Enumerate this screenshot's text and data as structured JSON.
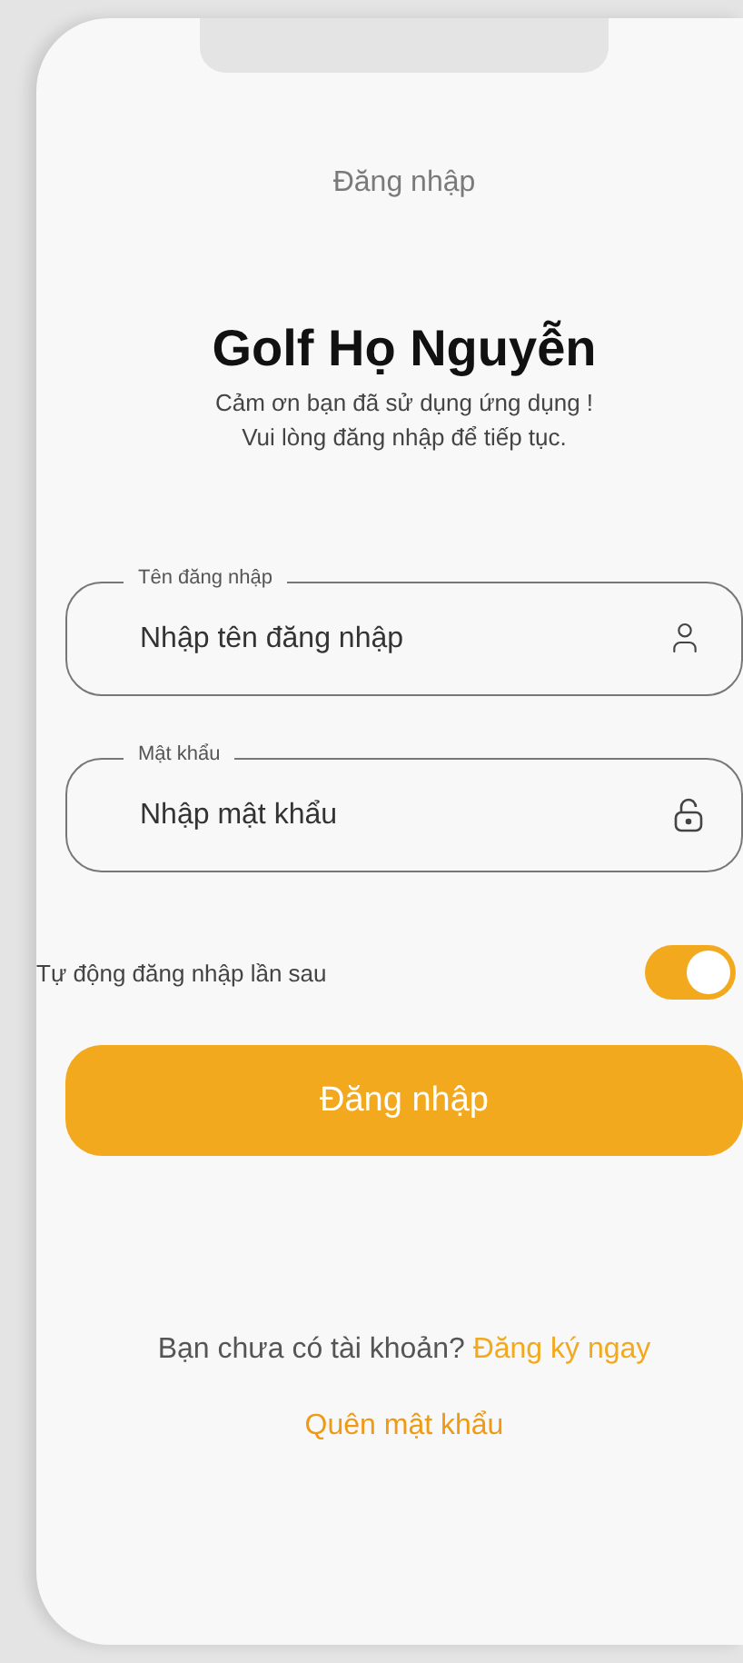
{
  "header": {
    "title": "Đăng nhập"
  },
  "app": {
    "name": "Golf Họ Nguyễn",
    "subtitle_lines": [
      "Cảm ơn bạn đã sử dụng ứng dụng !",
      "Vui lòng đăng nhập để tiếp tục."
    ]
  },
  "fields": [
    {
      "kind": "user",
      "label": "Tên đăng nhập",
      "placeholder": "Nhập tên đăng nhập"
    },
    {
      "kind": "password",
      "label": "Mật khẩu",
      "placeholder": "Nhập mật khẩu"
    }
  ],
  "auto_login": {
    "label": "Tự động đăng nhập lần sau",
    "on": true
  },
  "login_button": "Đăng nhập",
  "signup": {
    "prompt": "Bạn chưa có tài khoản?",
    "link": "Đăng ký ngay"
  },
  "forgot_password": "Quên mật khẩu"
}
